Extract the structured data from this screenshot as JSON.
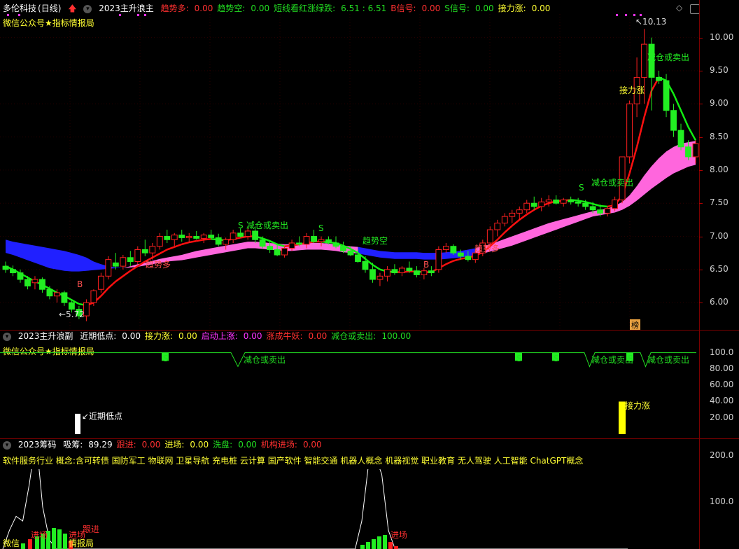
{
  "main": {
    "stock_name": "多伦科技",
    "period": "(日线)",
    "indicator_name": "2023主升浪主",
    "fields": [
      {
        "label": "趋势多:",
        "value": "0.00",
        "color": "red"
      },
      {
        "label": "趋势空:",
        "value": "0.00",
        "color": "green"
      },
      {
        "label": "短线看红涨绿跌:",
        "value": "6.51 : 6.51",
        "color": "green"
      },
      {
        "label": "B信号:",
        "value": "0.00",
        "color": "red"
      },
      {
        "label": "S信号:",
        "value": "0.00",
        "color": "green"
      },
      {
        "label": "接力涨:",
        "value": "0.00",
        "color": "yellow"
      }
    ],
    "watermark": "微信公众号★指标情报局",
    "high_label": "10.13",
    "low_label": "5.72",
    "bang_label": "榜",
    "annotations": [
      "减仓或卖出",
      "减仓或卖出",
      "减仓或卖出",
      "减仓或卖出",
      "趋势多",
      "趋势空",
      "趋势多",
      "接力涨",
      "S",
      "S",
      "S",
      "S",
      "B",
      "B"
    ],
    "yticks": [
      "10.00",
      "9.50",
      "9.00",
      "8.50",
      "8.00",
      "7.50",
      "7.00",
      "6.50",
      "6.00"
    ]
  },
  "sub1": {
    "indicator_name": "2023主升浪副",
    "fields": [
      {
        "label": "近期低点:",
        "value": "0.00",
        "color": "white"
      },
      {
        "label": "接力涨:",
        "value": "0.00",
        "color": "yellow"
      },
      {
        "label": "启动上涨:",
        "value": "0.00",
        "color": "magenta"
      },
      {
        "label": "涨成牛妖:",
        "value": "0.00",
        "color": "red"
      },
      {
        "label": "减仓或卖出:",
        "value": "100.00",
        "color": "green"
      }
    ],
    "watermark": "微信公众号★指标情报局",
    "low_point_label": "近期低点",
    "relay_label": "接力涨",
    "sell_labels": [
      "减仓或卖出",
      "减仓或卖出",
      "减仓或卖出"
    ],
    "s_labels": [
      "S",
      "S",
      "S",
      "S"
    ],
    "yticks": [
      "100.0",
      "80.00",
      "60.00",
      "40.00",
      "20.00"
    ]
  },
  "sub2": {
    "indicator_name": "2023筹码",
    "fields": [
      {
        "label": "吸筹:",
        "value": "89.29",
        "color": "white"
      },
      {
        "label": "跟进:",
        "value": "0.00",
        "color": "red"
      },
      {
        "label": "进场:",
        "value": "0.00",
        "color": "yellow"
      },
      {
        "label": "洗盘:",
        "value": "0.00",
        "color": "green"
      },
      {
        "label": "机构进场:",
        "value": "0.00",
        "color": "red"
      }
    ],
    "concepts": "软件服务行业  概念:含可转债 国防军工 物联网 卫星导航 充电桩 云计算 国产软件 智能交通 机器人概念 机器视觉 职业教育 无人驾驶 人工智能 ChatGPT概念",
    "labels": [
      "跟进",
      "进场",
      "进场",
      "进场",
      "情报局",
      "微信"
    ],
    "yticks": [
      "200.0",
      "100.0"
    ]
  },
  "chart_data": {
    "type": "candlestick",
    "ylim": [
      5.6,
      10.25
    ],
    "candles": [
      [
        6.55,
        6.62,
        6.45,
        6.5
      ],
      [
        6.5,
        6.56,
        6.4,
        6.45
      ],
      [
        6.45,
        6.5,
        6.3,
        6.35
      ],
      [
        6.35,
        6.4,
        6.2,
        6.25
      ],
      [
        6.3,
        6.4,
        6.2,
        6.35
      ],
      [
        6.35,
        6.38,
        6.15,
        6.2
      ],
      [
        6.2,
        6.25,
        6.05,
        6.1
      ],
      [
        6.1,
        6.2,
        6.0,
        6.15
      ],
      [
        6.15,
        6.18,
        5.95,
        6.0
      ],
      [
        6.0,
        6.05,
        5.85,
        5.9
      ],
      [
        5.9,
        5.95,
        5.75,
        5.8
      ],
      [
        5.8,
        6.05,
        5.72,
        6.0
      ],
      [
        6.0,
        6.2,
        5.95,
        6.18
      ],
      [
        6.2,
        6.45,
        6.15,
        6.4
      ],
      [
        6.4,
        6.7,
        6.35,
        6.65
      ],
      [
        6.6,
        6.75,
        6.5,
        6.55
      ],
      [
        6.55,
        6.72,
        6.5,
        6.68
      ],
      [
        6.68,
        6.78,
        6.55,
        6.62
      ],
      [
        6.62,
        6.85,
        6.58,
        6.8
      ],
      [
        6.8,
        6.95,
        6.7,
        6.75
      ],
      [
        6.75,
        6.9,
        6.65,
        6.85
      ],
      [
        6.85,
        7.05,
        6.8,
        7.0
      ],
      [
        7.0,
        7.1,
        6.9,
        6.95
      ],
      [
        6.95,
        7.05,
        6.85,
        7.02
      ],
      [
        7.02,
        7.1,
        6.92,
        6.98
      ],
      [
        6.98,
        7.05,
        6.9,
        7.0
      ],
      [
        7.0,
        7.08,
        6.95,
        6.97
      ],
      [
        6.97,
        7.05,
        6.9,
        7.02
      ],
      [
        7.02,
        7.1,
        6.95,
        6.98
      ],
      [
        6.98,
        7.04,
        6.85,
        6.88
      ],
      [
        6.88,
        6.98,
        6.8,
        6.95
      ],
      [
        6.95,
        7.1,
        6.9,
        7.05
      ],
      [
        7.05,
        7.12,
        6.98,
        7.0
      ],
      [
        7.0,
        7.12,
        6.95,
        7.08
      ],
      [
        7.08,
        7.15,
        6.9,
        6.95
      ],
      [
        6.95,
        7.0,
        6.82,
        6.85
      ],
      [
        6.85,
        6.92,
        6.75,
        6.8
      ],
      [
        6.8,
        6.88,
        6.7,
        6.72
      ],
      [
        6.72,
        6.85,
        6.68,
        6.82
      ],
      [
        6.82,
        6.95,
        6.78,
        6.9
      ],
      [
        6.9,
        7.0,
        6.85,
        6.88
      ],
      [
        6.88,
        7.05,
        6.82,
        7.0
      ],
      [
        7.0,
        7.1,
        6.9,
        6.92
      ],
      [
        6.92,
        7.0,
        6.85,
        6.95
      ],
      [
        6.95,
        7.0,
        6.88,
        6.9
      ],
      [
        6.9,
        7.0,
        6.82,
        6.85
      ],
      [
        6.85,
        6.92,
        6.75,
        6.78
      ],
      [
        6.78,
        6.85,
        6.7,
        6.72
      ],
      [
        6.72,
        6.8,
        6.6,
        6.62
      ],
      [
        6.62,
        6.7,
        6.45,
        6.5
      ],
      [
        6.5,
        6.6,
        6.3,
        6.35
      ],
      [
        6.35,
        6.45,
        6.25,
        6.4
      ],
      [
        6.4,
        6.55,
        6.32,
        6.5
      ],
      [
        6.5,
        6.58,
        6.42,
        6.45
      ],
      [
        6.45,
        6.55,
        6.4,
        6.52
      ],
      [
        6.52,
        6.62,
        6.45,
        6.48
      ],
      [
        6.48,
        6.55,
        6.38,
        6.42
      ],
      [
        6.42,
        6.52,
        6.35,
        6.48
      ],
      [
        6.48,
        6.55,
        6.4,
        6.45
      ],
      [
        6.5,
        6.85,
        6.45,
        6.8
      ],
      [
        6.8,
        6.9,
        6.75,
        6.85
      ],
      [
        6.85,
        6.88,
        6.72,
        6.75
      ],
      [
        6.75,
        6.8,
        6.65,
        6.7
      ],
      [
        6.7,
        6.78,
        6.62,
        6.65
      ],
      [
        6.65,
        6.8,
        6.6,
        6.75
      ],
      [
        6.75,
        6.95,
        6.7,
        6.9
      ],
      [
        6.9,
        7.15,
        6.85,
        7.1
      ],
      [
        7.1,
        7.25,
        7.0,
        7.2
      ],
      [
        7.2,
        7.35,
        7.15,
        7.3
      ],
      [
        7.3,
        7.4,
        7.2,
        7.35
      ],
      [
        7.35,
        7.45,
        7.25,
        7.4
      ],
      [
        7.4,
        7.55,
        7.35,
        7.5
      ],
      [
        7.5,
        7.6,
        7.4,
        7.45
      ],
      [
        7.45,
        7.58,
        7.38,
        7.52
      ],
      [
        7.52,
        7.62,
        7.45,
        7.55
      ],
      [
        7.55,
        7.62,
        7.48,
        7.5
      ],
      [
        7.5,
        7.58,
        7.45,
        7.55
      ],
      [
        7.55,
        7.6,
        7.48,
        7.52
      ],
      [
        7.52,
        7.58,
        7.45,
        7.5
      ],
      [
        7.5,
        7.55,
        7.4,
        7.45
      ],
      [
        7.45,
        7.52,
        7.35,
        7.4
      ],
      [
        7.4,
        7.48,
        7.3,
        7.35
      ],
      [
        7.35,
        7.45,
        7.3,
        7.42
      ],
      [
        7.42,
        7.6,
        7.38,
        7.55
      ],
      [
        7.55,
        8.2,
        7.5,
        8.2
      ],
      [
        8.2,
        9.05,
        8.1,
        9.0
      ],
      [
        9.0,
        9.7,
        8.8,
        9.4
      ],
      [
        9.4,
        10.13,
        9.0,
        9.9
      ],
      [
        9.9,
        10.0,
        8.9,
        9.4
      ],
      [
        9.4,
        9.5,
        9.3,
        9.35
      ],
      [
        9.35,
        9.45,
        8.8,
        8.9
      ],
      [
        8.9,
        9.0,
        8.5,
        8.6
      ],
      [
        8.6,
        8.7,
        8.3,
        8.35
      ],
      [
        8.35,
        8.45,
        8.15,
        8.2
      ],
      [
        8.2,
        8.45,
        8.1,
        8.4
      ]
    ],
    "ma_values": [
      6.55,
      6.5,
      6.44,
      6.38,
      6.32,
      6.27,
      6.21,
      6.15,
      6.1,
      6.04,
      5.98,
      5.96,
      6.0,
      6.1,
      6.22,
      6.32,
      6.4,
      6.48,
      6.55,
      6.62,
      6.68,
      6.74,
      6.8,
      6.84,
      6.88,
      6.91,
      6.93,
      6.95,
      6.96,
      6.95,
      6.94,
      6.96,
      6.98,
      7.0,
      7.0,
      6.97,
      6.93,
      6.88,
      6.85,
      6.86,
      6.88,
      6.9,
      6.92,
      6.92,
      6.91,
      6.9,
      6.86,
      6.81,
      6.75,
      6.66,
      6.57,
      6.5,
      6.47,
      6.46,
      6.46,
      6.47,
      6.47,
      6.46,
      6.46,
      6.52,
      6.58,
      6.63,
      6.66,
      6.68,
      6.71,
      6.76,
      6.85,
      6.95,
      7.06,
      7.16,
      7.25,
      7.33,
      7.4,
      7.46,
      7.5,
      7.53,
      7.54,
      7.55,
      7.54,
      7.52,
      7.49,
      7.46,
      7.45,
      7.47,
      7.62,
      7.95,
      8.35,
      8.8,
      9.2,
      9.4,
      9.35,
      9.15,
      8.9,
      8.65,
      8.45
    ],
    "band_upper": [
      6.95,
      6.92,
      6.9,
      6.88,
      6.86,
      6.84,
      6.82,
      6.8,
      6.78,
      6.75,
      6.72,
      6.68,
      6.62,
      6.58,
      6.55,
      6.53,
      6.52,
      6.55,
      6.58,
      6.6,
      6.63,
      6.66,
      6.68,
      6.7,
      6.72,
      6.75,
      6.78,
      6.8,
      6.82,
      6.84,
      6.86,
      6.88,
      6.9,
      6.92,
      6.92,
      6.91,
      6.9,
      6.89,
      6.88,
      6.88,
      6.89,
      6.9,
      6.9,
      6.9,
      6.89,
      6.88,
      6.86,
      6.85,
      6.84,
      6.82,
      6.8,
      6.78,
      6.77,
      6.76,
      6.76,
      6.76,
      6.76,
      6.75,
      6.75,
      6.75,
      6.76,
      6.77,
      6.78,
      6.8,
      6.82,
      6.85,
      6.88,
      6.92,
      6.96,
      7.0,
      7.04,
      7.08,
      7.12,
      7.16,
      7.2,
      7.23,
      7.26,
      7.29,
      7.32,
      7.35,
      7.38,
      7.4,
      7.42,
      7.46,
      7.52,
      7.62,
      7.76,
      7.92,
      8.06,
      8.18,
      8.28,
      8.35,
      8.4,
      8.42,
      8.44
    ],
    "band_lower": [
      6.75,
      6.72,
      6.68,
      6.64,
      6.6,
      6.56,
      6.52,
      6.5,
      6.48,
      6.47,
      6.47,
      6.48,
      6.49,
      6.5,
      6.51,
      6.52,
      6.52,
      6.53,
      6.54,
      6.56,
      6.58,
      6.6,
      6.62,
      6.63,
      6.64,
      6.66,
      6.68,
      6.7,
      6.72,
      6.74,
      6.76,
      6.78,
      6.8,
      6.82,
      6.82,
      6.81,
      6.8,
      6.79,
      6.78,
      6.78,
      6.79,
      6.8,
      6.8,
      6.8,
      6.79,
      6.78,
      6.76,
      6.75,
      6.74,
      6.72,
      6.7,
      6.68,
      6.67,
      6.66,
      6.66,
      6.66,
      6.66,
      6.65,
      6.65,
      6.65,
      6.66,
      6.67,
      6.68,
      6.7,
      6.72,
      6.74,
      6.77,
      6.8,
      6.83,
      6.86,
      6.9,
      6.94,
      6.98,
      7.02,
      7.06,
      7.1,
      7.14,
      7.18,
      7.22,
      7.26,
      7.3,
      7.32,
      7.34,
      7.36,
      7.4,
      7.46,
      7.54,
      7.63,
      7.72,
      7.8,
      7.88,
      7.95,
      8.0,
      8.05,
      8.08
    ],
    "chip_series": [
      0,
      40,
      70,
      60,
      140,
      240,
      90,
      20,
      0,
      0,
      0,
      0,
      0,
      0,
      0,
      0,
      0,
      0,
      0,
      0,
      0,
      0,
      0,
      0,
      0,
      0,
      0,
      0,
      0,
      0,
      0,
      0,
      0,
      0,
      0,
      0,
      0,
      0,
      0,
      0,
      0,
      0,
      0,
      0,
      0,
      0,
      0,
      0,
      0,
      0,
      0,
      0,
      0,
      0,
      60,
      180,
      200,
      160,
      40,
      0,
      0,
      0,
      0,
      0,
      0,
      0,
      0,
      0,
      0,
      0,
      0,
      0,
      0,
      0,
      0,
      0,
      0,
      0,
      0,
      0,
      0,
      0,
      0,
      0,
      0,
      0,
      0,
      0,
      0,
      0,
      0,
      0,
      0,
      0,
      0
    ],
    "sub1_ylim": [
      0,
      110
    ],
    "sub2_ylim": [
      0,
      300
    ]
  }
}
